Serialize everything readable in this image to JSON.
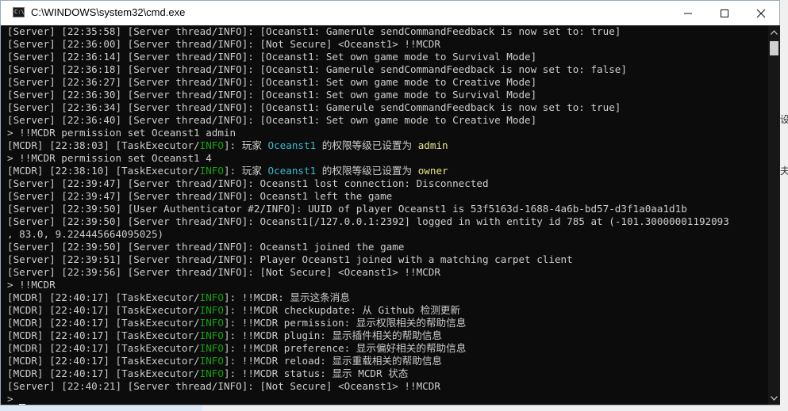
{
  "window": {
    "title": "C:\\WINDOWS\\system32\\cmd.exe",
    "icon_text": "C:\\"
  },
  "controls": {
    "minimize_icon": "minimize-icon",
    "maximize_icon": "maximize-icon",
    "close_icon": "close-icon"
  },
  "console_lines": [
    "[Server] [22:35:58] [Server thread/INFO]: [Oceanst1: Gamerule sendCommandFeedback is now set to: true]",
    "[Server] [22:36:00] [Server thread/INFO]: [Not Secure] <Oceanst1> !!MCDR",
    "[Server] [22:36:14] [Server thread/INFO]: [Oceanst1: Set own game mode to Survival Mode]",
    "[Server] [22:36:18] [Server thread/INFO]: [Oceanst1: Gamerule sendCommandFeedback is now set to: false]",
    "[Server] [22:36:27] [Server thread/INFO]: [Oceanst1: Set own game mode to Creative Mode]",
    "[Server] [22:36:30] [Server thread/INFO]: [Oceanst1: Set own game mode to Survival Mode]",
    "[Server] [22:36:34] [Server thread/INFO]: [Oceanst1: Gamerule sendCommandFeedback is now set to: true]",
    "[Server] [22:36:40] [Server thread/INFO]: [Oceanst1: Set own game mode to Creative Mode]",
    "> !!MCDR permission set Oceanst1 admin",
    "",
    "> !!MCDR permission set Oceanst1 4",
    "",
    "[Server] [22:39:47] [Server thread/INFO]: Oceanst1 lost connection: Disconnected",
    "[Server] [22:39:47] [Server thread/INFO]: Oceanst1 left the game",
    "[Server] [22:39:50] [User Authenticator #2/INFO]: UUID of player Oceanst1 is 53f5163d-1688-4a6b-bd57-d3f1a0aa1d1b",
    "[Server] [22:39:50] [Server thread/INFO]: Oceanst1[/127.0.0.1:2392] logged in with entity id 785 at (-101.30000001192093",
    ", 83.0, 9.224445664095025)",
    "[Server] [22:39:50] [Server thread/INFO]: Oceanst1 joined the game",
    "[Server] [22:39:51] [Server thread/INFO]: Player Oceanst1 joined with a matching carpet client",
    "[Server] [22:39:56] [Server thread/INFO]: [Not Secure] <Oceanst1> !!MCDR",
    "> !!MCDR"
  ],
  "mcdr_permission_lines": [
    {
      "prefix": "[MCDR] [22:38:03] [TaskExecutor/",
      "level": "INFO",
      "mid": "]: 玩家 ",
      "player": "Oceanst1",
      "text": " 的权限等级已设置为 ",
      "value": "admin"
    },
    {
      "prefix": "[MCDR] [22:38:10] [TaskExecutor/",
      "level": "INFO",
      "mid": "]: 玩家 ",
      "player": "Oceanst1",
      "text": " 的权限等级已设置为 ",
      "value": "owner"
    }
  ],
  "mcdr_help_lines": [
    {
      "prefix": "[MCDR] [22:40:17] [TaskExecutor/",
      "level": "INFO",
      "text": "]: !!MCDR: 显示这条消息"
    },
    {
      "prefix": "[MCDR] [22:40:17] [TaskExecutor/",
      "level": "INFO",
      "text": "]: !!MCDR checkupdate: 从 Github 检测更新"
    },
    {
      "prefix": "[MCDR] [22:40:17] [TaskExecutor/",
      "level": "INFO",
      "text": "]: !!MCDR permission: 显示权限相关的帮助信息"
    },
    {
      "prefix": "[MCDR] [22:40:17] [TaskExecutor/",
      "level": "INFO",
      "text": "]: !!MCDR plugin: 显示插件相关的帮助信息"
    },
    {
      "prefix": "[MCDR] [22:40:17] [TaskExecutor/",
      "level": "INFO",
      "text": "]: !!MCDR preference: 显示偏好相关的帮助信息"
    },
    {
      "prefix": "[MCDR] [22:40:17] [TaskExecutor/",
      "level": "INFO",
      "text": "]: !!MCDR reload: 显示重载相关的帮助信息"
    },
    {
      "prefix": "[MCDR] [22:40:17] [TaskExecutor/",
      "level": "INFO",
      "text": "]: !!MCDR status: 显示 MCDR 状态"
    }
  ],
  "last_line": "[Server] [22:40:21] [Server thread/INFO]: [Not Secure] <Oceanst1> !!MCDR",
  "prompt": ">",
  "side_chars": [
    "设",
    "夫"
  ],
  "colors": {
    "console_bg": "#0c0c0c",
    "console_text": "#cccccc",
    "info_green": "#13a10e",
    "player_cyan": "#3ab8c8",
    "value_yellow": "#e6e68a"
  }
}
